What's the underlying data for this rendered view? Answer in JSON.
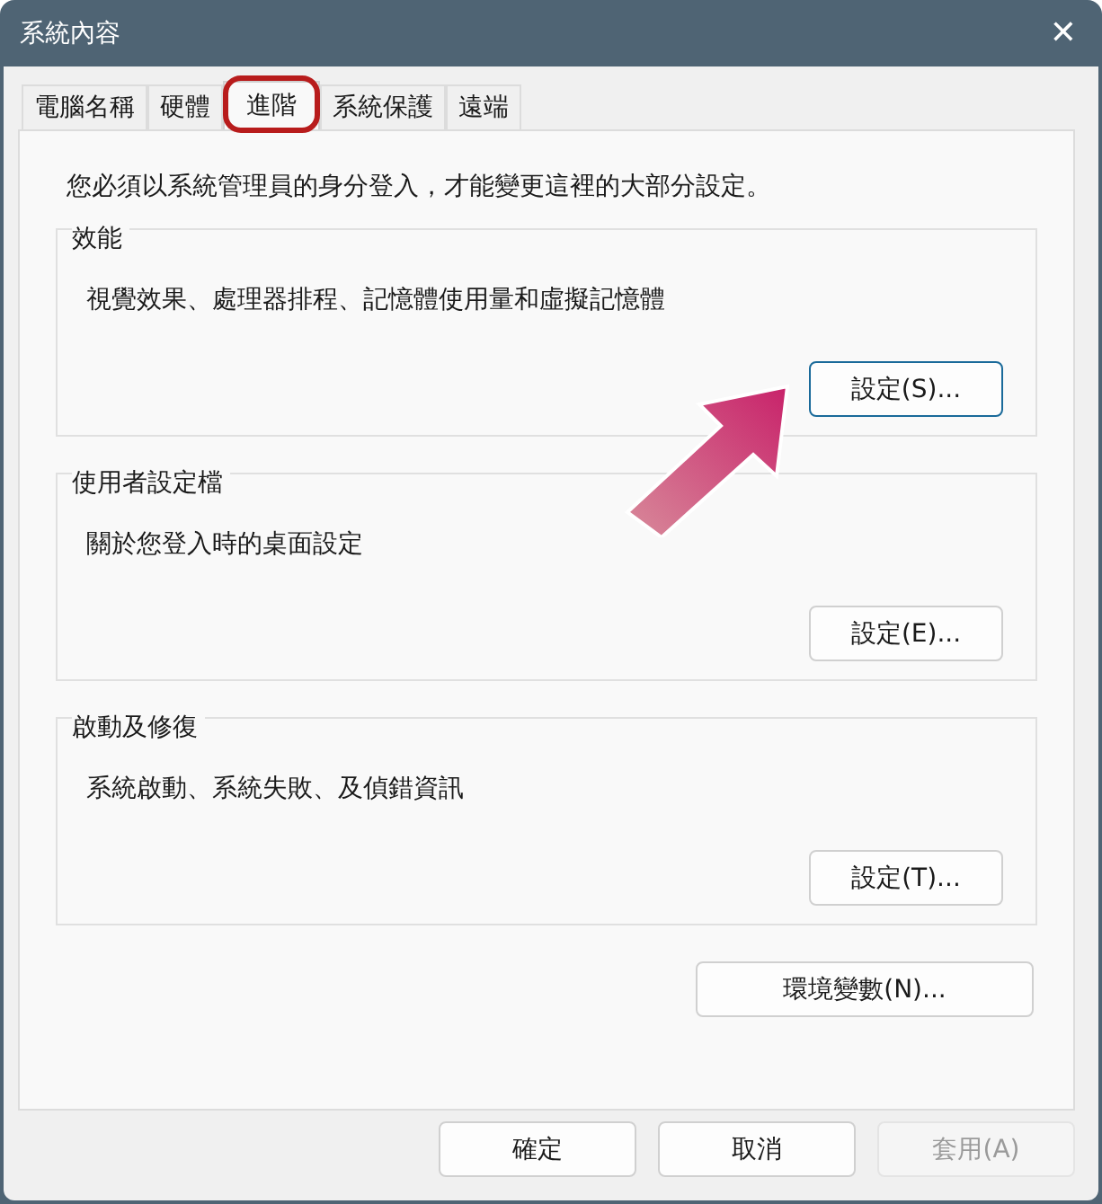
{
  "window": {
    "title": "系統內容",
    "close": "✕"
  },
  "tabs": [
    {
      "label": "電腦名稱",
      "selected": false,
      "circled": false
    },
    {
      "label": "硬體",
      "selected": false,
      "circled": false
    },
    {
      "label": "進階",
      "selected": true,
      "circled": true
    },
    {
      "label": "系統保護",
      "selected": false,
      "circled": false
    },
    {
      "label": "遠端",
      "selected": false,
      "circled": false
    }
  ],
  "notice": "您必須以系統管理員的身分登入，才能變更這裡的大部分設定。",
  "groups": [
    {
      "title": "效能",
      "description": "視覺效果、處理器排程、記憶體使用量和虛擬記憶體",
      "button": "設定(S)...",
      "focused": true,
      "pointed": true
    },
    {
      "title": "使用者設定檔",
      "description": "關於您登入時的桌面設定",
      "button": "設定(E)...",
      "focused": false,
      "pointed": false
    },
    {
      "title": "啟動及修復",
      "description": "系統啟動、系統失敗、及偵錯資訊",
      "button": "設定(T)...",
      "focused": false,
      "pointed": false
    }
  ],
  "environment_button": "環境變數(N)...",
  "footer_buttons": [
    {
      "label": "確定",
      "disabled": false
    },
    {
      "label": "取消",
      "disabled": false
    },
    {
      "label": "套用(A)",
      "disabled": true
    }
  ]
}
